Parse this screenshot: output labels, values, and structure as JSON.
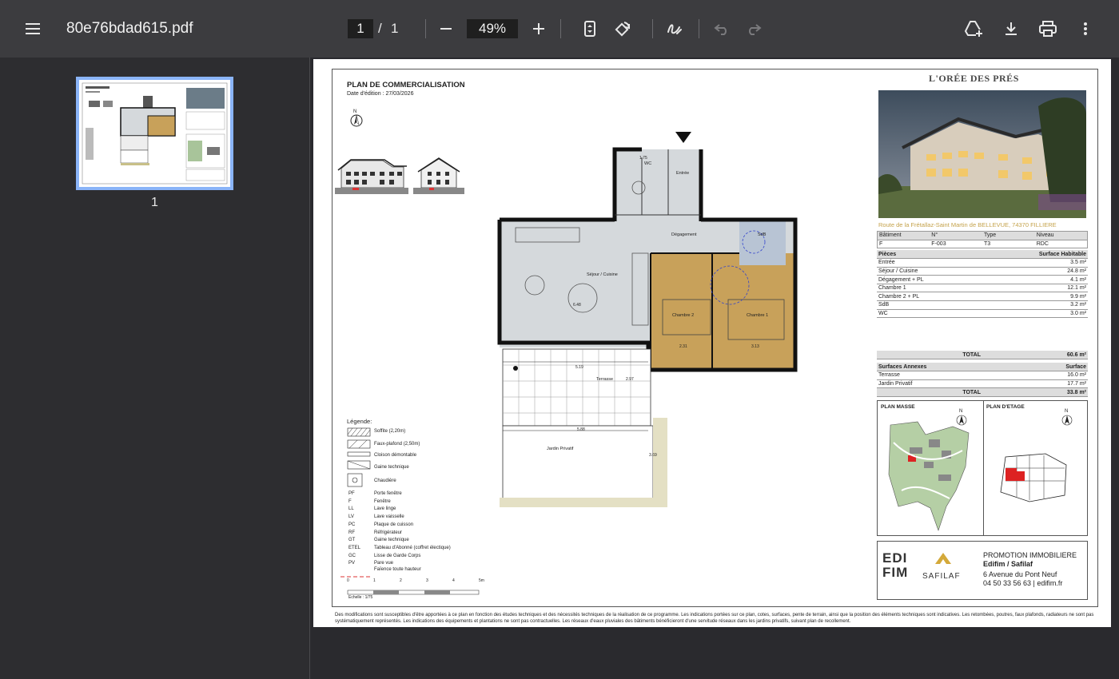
{
  "app": {
    "file_name": "80e76bdad615.pdf",
    "current_page": "1",
    "page_sep": "/",
    "total_pages": "1",
    "zoom": "49%"
  },
  "icons": [
    "menu-icon",
    "minus-icon",
    "plus-icon",
    "fit-page-icon",
    "rotate-icon",
    "draw-icon",
    "undo-icon",
    "redo-icon",
    "drive-add-icon",
    "download-icon",
    "print-icon",
    "more-vert-icon"
  ],
  "sidebar": {
    "thumb_label": "1"
  },
  "doc": {
    "title": "PLAN DE COMMERCIALISATION",
    "date_label": "Date d'édition :",
    "date": "27/03/2026",
    "north": "N",
    "brand": "L'ORÉE DES PRÉS",
    "address": "Route de la Frétallaz-Saint Martin de BELLEVUE, 74370 FILLIERE",
    "info_headers": [
      "Bâtiment",
      "N°",
      "Type",
      "Niveau"
    ],
    "info_values": [
      "F",
      "F-003",
      "T3",
      "RDC"
    ],
    "rooms_header": [
      "Pièces",
      "Surface Habitable"
    ],
    "rooms": [
      [
        "Entrée",
        "3.5 m²"
      ],
      [
        "Séjour / Cuisine",
        "24.8 m²"
      ],
      [
        "Dégagement + PL",
        "4.1 m²"
      ],
      [
        "Chambre 1",
        "12.1 m²"
      ],
      [
        "Chambre 2 + PL",
        "9.9 m²"
      ],
      [
        "SdB",
        "3.2 m²"
      ],
      [
        "WC",
        "3.0 m²"
      ]
    ],
    "total_label": "TOTAL",
    "total_value": "60.6 m²",
    "annex_header": [
      "Surfaces Annexes",
      "Surface"
    ],
    "annexes": [
      [
        "Terrasse",
        "16.0 m²"
      ],
      [
        "Jardin Privatif",
        "17.7 m²"
      ]
    ],
    "annex_total_label": "TOTAL",
    "annex_total_value": "33.8 m²",
    "plan_masse": "PLAN MASSE",
    "plan_etage": "PLAN D'ETAGE",
    "promoter_line1": "PROMOTION IMMOBILIERE",
    "promoter_line2": "Edifim / Safilaf",
    "promoter_line3": "6 Avenue du Pont Neuf",
    "promoter_line4": "04 50 33 56 63 | edifim.fr",
    "logo_edifim": "EDIFIM",
    "logo_safilaf": "SAFILAF",
    "legend_title": "Légende:",
    "legend_symbols": [
      "Soffite (2,20m)",
      "Faux-plafond (2,50m)",
      "Cloison démontable",
      "Gaine technique",
      "Chaudière"
    ],
    "legend_codes": [
      [
        "PF",
        "Porte fenêtre"
      ],
      [
        "F",
        "Fenêtre"
      ],
      [
        "LL",
        "Lave linge"
      ],
      [
        "LV",
        "Lave vaisselle"
      ],
      [
        "PC",
        "Plaque de cuisson"
      ],
      [
        "RF",
        "Réfrigérateur"
      ],
      [
        "GT",
        "Gaine technique"
      ],
      [
        "ETEL",
        "Tableau d'Abonné (coffret électique)"
      ],
      [
        "GC",
        "Lisse de Garde Corps"
      ],
      [
        "PV",
        "Pare vue"
      ]
    ],
    "legend_faience": "Faïence toute hauteur",
    "scale_ticks": [
      "0",
      "1",
      "2",
      "3",
      "4",
      "5m"
    ],
    "scale_label": "Echelle : 1/75",
    "rooms_plan": {
      "entree": "Entrée",
      "degagement": "Dégagement",
      "sejour": "Séjour / Cuisine",
      "chambre2": "Chambre 2",
      "chambre1": "Chambre 1",
      "sdb": "SdB",
      "wc": "WC",
      "terrasse": "Terrasse",
      "jardin": "Jardin Privatif"
    },
    "dims": {
      "d1": "5.19",
      "d2": "5.88",
      "d3": "3.69",
      "d4": "6.48",
      "d5": "2.97",
      "d6": "2.31",
      "d7": "3.13",
      "d8": "1.75"
    },
    "disclaimer": "Des modifications sont susceptibles d'être apportées à ce plan en fonction des études techniques et des nécessités techniques de la réalisation de ce programme.   Les indications portées sur ce plan, cotes, surfaces, pente de terrain, ainsi que la position des éléments techniques sont indicatives.  Les retombées, poutres, faux plafonds, radiateurs ne sont pas systématiquement représentés. Les indications des équipements et plantations ne sont pas contractuelles. Les réseaux d'eaux pluviales des bâtiments bénéficieront d'une servitude réseaux dans les jardins privatifs, suivant plan de recollement."
  },
  "colors": {
    "toolbar": "#3c3c3f",
    "background": "#2a2a2e",
    "thumb_highlight": "#8ab4f8",
    "room_ochre": "#c8a15a",
    "room_grey": "#d5d9dc",
    "brand_gold": "#c4a24a"
  }
}
